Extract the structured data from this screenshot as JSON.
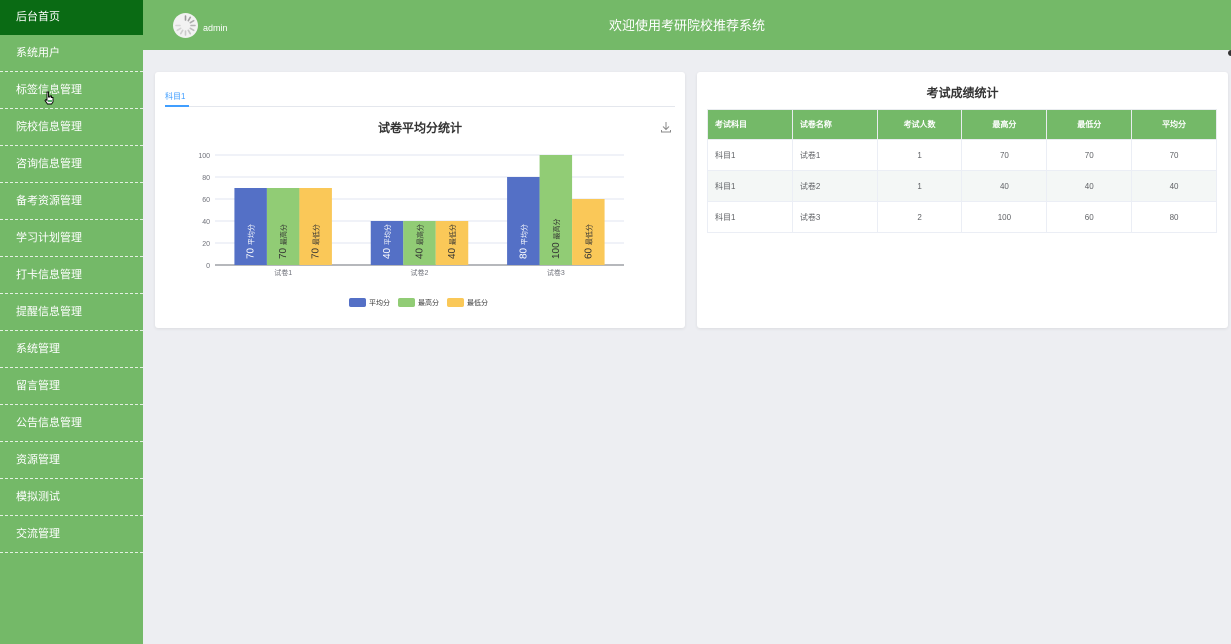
{
  "sidebar": {
    "items": [
      {
        "label": "后台首页"
      },
      {
        "label": "系统用户"
      },
      {
        "label": "标签信息管理"
      },
      {
        "label": "院校信息管理"
      },
      {
        "label": "咨询信息管理"
      },
      {
        "label": "备考资源管理"
      },
      {
        "label": "学习计划管理"
      },
      {
        "label": "打卡信息管理"
      },
      {
        "label": "提醒信息管理"
      },
      {
        "label": "系统管理"
      },
      {
        "label": "留言管理"
      },
      {
        "label": "公告信息管理"
      },
      {
        "label": "资源管理"
      },
      {
        "label": "模拟测试"
      },
      {
        "label": "交流管理"
      }
    ]
  },
  "header": {
    "username": "admin",
    "title": "欢迎使用考研院校推荐系统"
  },
  "chart_panel": {
    "tabs": [
      {
        "label": "科目1"
      }
    ],
    "download_icon": "download-icon"
  },
  "chart_data": {
    "type": "bar",
    "title": "试卷平均分统计",
    "categories": [
      "试卷1",
      "试卷2",
      "试卷3"
    ],
    "series": [
      {
        "name": "平均分",
        "values": [
          70,
          40,
          80
        ],
        "color": "#5470c6"
      },
      {
        "name": "最高分",
        "values": [
          70,
          40,
          100
        ],
        "color": "#91cc75"
      },
      {
        "name": "最低分",
        "values": [
          70,
          40,
          60
        ],
        "color": "#fac858"
      }
    ],
    "yticks": [
      0,
      20,
      40,
      60,
      80,
      100
    ],
    "ylim": [
      0,
      100
    ],
    "xlabel": "",
    "ylabel": "",
    "legend_position": "bottom",
    "grid": true,
    "data_label_style": "rotated value and series name inside bar"
  },
  "table_panel": {
    "title": "考试成绩统计",
    "columns": [
      "考试科目",
      "试卷名称",
      "考试人数",
      "最高分",
      "最低分",
      "平均分"
    ],
    "rows": [
      [
        "科目1",
        "试卷1",
        "1",
        "70",
        "70",
        "70"
      ],
      [
        "科目1",
        "试卷2",
        "1",
        "40",
        "40",
        "40"
      ],
      [
        "科目1",
        "试卷3",
        "2",
        "100",
        "60",
        "80"
      ]
    ]
  },
  "colors": {
    "sidebar_bg": "#74b968",
    "sidebar_active": "#0a6b14",
    "header_bg": "#74b968",
    "page_bg": "#edeef2",
    "tab_active": "#409eff",
    "table_header": "#74b968"
  }
}
